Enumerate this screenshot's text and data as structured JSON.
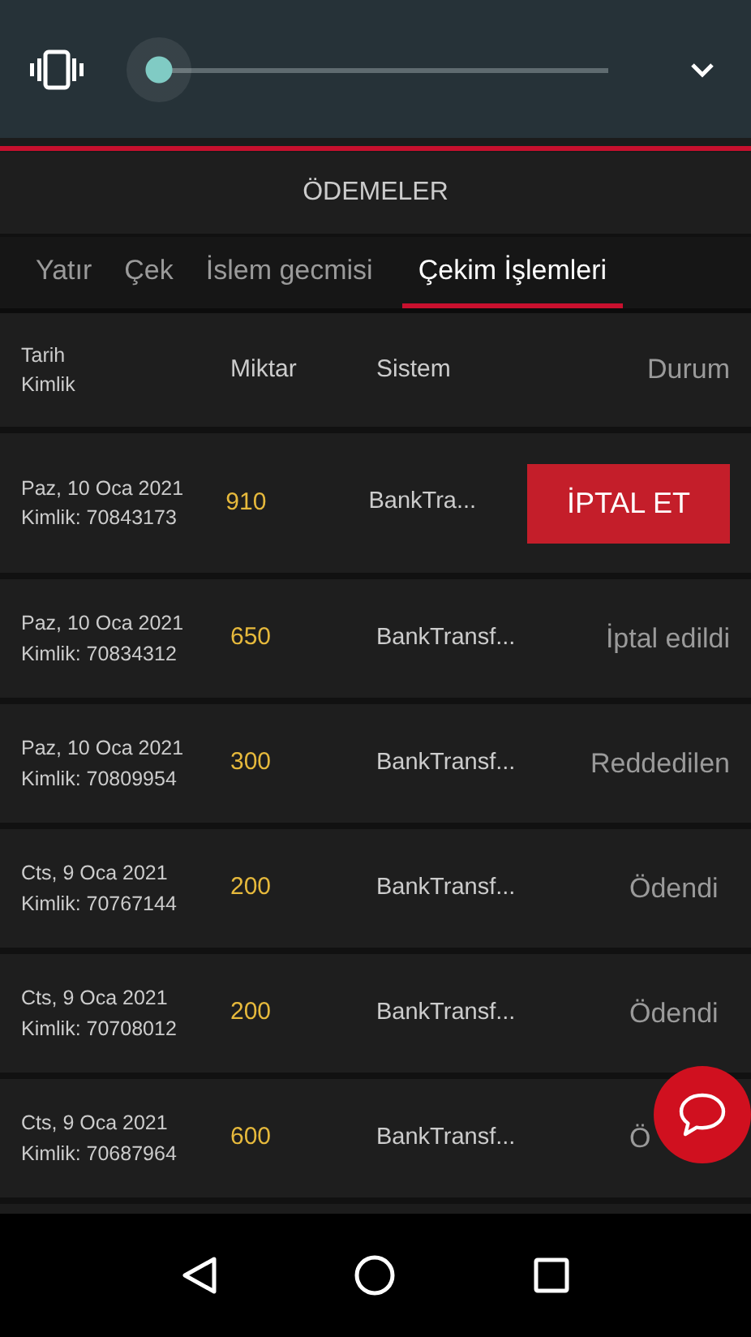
{
  "volume_panel": {
    "slider": {
      "level": 0.0
    }
  },
  "title": "ÖDEMELER",
  "tabs": [
    {
      "label": "Yatır",
      "selected": false
    },
    {
      "label": "Çek",
      "selected": false
    },
    {
      "label": "İslem gecmisi",
      "selected": false
    },
    {
      "label": "Çekim İşlemleri",
      "selected": true
    }
  ],
  "table": {
    "columns": [
      {
        "label": "Tarih",
        "sublabel": "Kimlik"
      },
      {
        "label": "Miktar"
      },
      {
        "label": "Sistem"
      },
      {
        "label": "Durum"
      }
    ],
    "rows": [
      {
        "date": "Paz, 10 Oca 2021",
        "id": "Kimlik: 70843173",
        "amount": "910",
        "system": "BankTra...",
        "status": {
          "kind": "button",
          "text": "İPTAL ET"
        }
      },
      {
        "date": "Paz, 10 Oca 2021",
        "id": "Kimlik: 70834312",
        "amount": "650",
        "system": "BankTransf...",
        "status": {
          "kind": "text",
          "text": "İptal edildi"
        }
      },
      {
        "date": "Paz, 10 Oca 2021",
        "id": "Kimlik: 70809954",
        "amount": "300",
        "system": "BankTransf...",
        "status": {
          "kind": "text",
          "text": "Reddedilen"
        }
      },
      {
        "date": "Cts, 9 Oca 2021",
        "id": "Kimlik: 70767144",
        "amount": "200",
        "system": "BankTransf...",
        "status": {
          "kind": "text",
          "text": "Ödendi"
        }
      },
      {
        "date": "Cts, 9 Oca 2021",
        "id": "Kimlik: 70708012",
        "amount": "200",
        "system": "BankTransf...",
        "status": {
          "kind": "text",
          "text": "Ödendi"
        }
      },
      {
        "date": "Cts, 9 Oca 2021",
        "id": "Kimlik: 70687964",
        "amount": "600",
        "system": "BankTransf...",
        "status": {
          "kind": "text",
          "text": "Ö"
        }
      }
    ]
  }
}
